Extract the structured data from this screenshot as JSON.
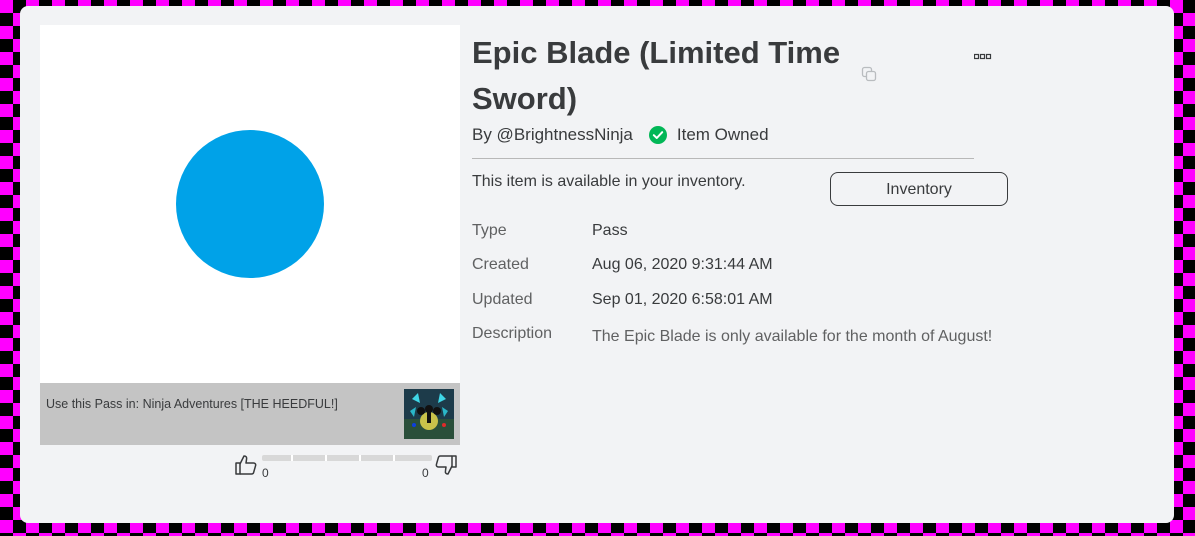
{
  "item": {
    "title": "Epic Blade (Limited Time Sword)",
    "byline": "By @BrightnessNinja",
    "owned_status": "Item Owned",
    "availability_text": "This item is available in your inventory.",
    "inventory_button": "Inventory",
    "thumbnail_color": "#00a2e8"
  },
  "use_pass": {
    "prefix": "Use this Pass in: ",
    "game_name": "Ninja Adventures [THE HEEDFUL!]"
  },
  "votes": {
    "up": "0",
    "down": "0"
  },
  "details": [
    {
      "label": "Type",
      "value": "Pass"
    },
    {
      "label": "Created",
      "value": "Aug 06, 2020 9:31:44 AM"
    },
    {
      "label": "Updated",
      "value": "Sep 01, 2020 6:58:01 AM"
    },
    {
      "label": "Description",
      "value": "The Epic Blade is only available for the month of August!"
    }
  ],
  "colors": {
    "owned_green": "#02b757",
    "card_bg": "#f2f3f5",
    "text": "#393b3d"
  }
}
